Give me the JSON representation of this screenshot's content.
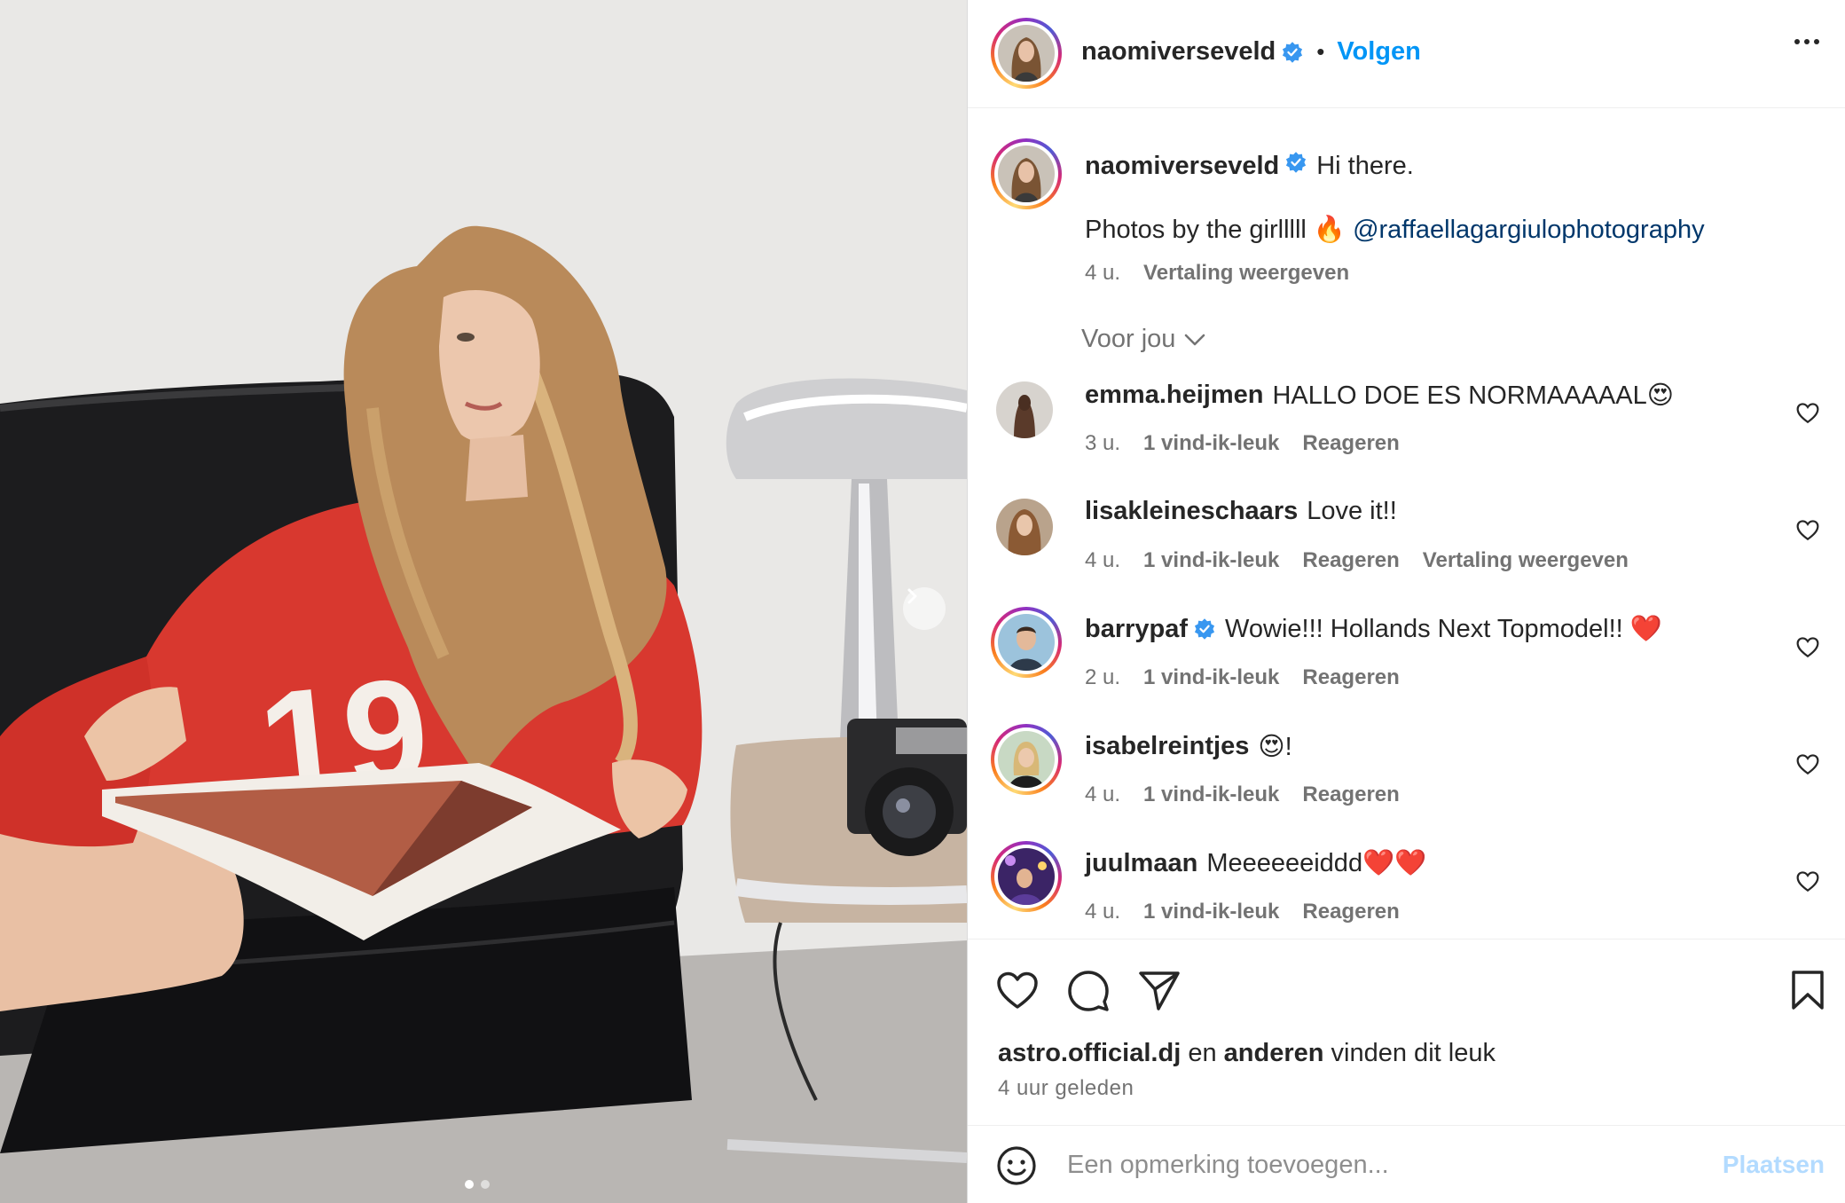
{
  "post": {
    "author": "naomiverseveld",
    "follow_label": "Volgen",
    "caption_text": "Hi there.",
    "caption_line2_prefix": "Photos by the girlllll 🔥",
    "caption_mention": "@raffaellagargiulophotography",
    "caption_time": "4 u.",
    "caption_translate": "Vertaling weergeven",
    "section_label": "Voor jou",
    "likes_user": "astro.official.dj",
    "likes_en": "en",
    "likes_others": "anderen",
    "likes_suffix": "vinden dit leuk",
    "time_ago": "4 uur geleden",
    "comment_placeholder": "Een opmerking toevoegen...",
    "post_label": "Plaatsen",
    "carousel": {
      "current": 1,
      "total": 2
    }
  },
  "comments": [
    {
      "user": "emma.heijmen",
      "verified": false,
      "text": "HALLO DOE ES NORMAAAAAL😍",
      "time": "3 u.",
      "likes": "1 vind-ik-leuk",
      "reply": "Reageren",
      "translate": "",
      "story_ring": false
    },
    {
      "user": "lisakleineschaars",
      "verified": false,
      "text": "Love it!!",
      "time": "4 u.",
      "likes": "1 vind-ik-leuk",
      "reply": "Reageren",
      "translate": "Vertaling weergeven",
      "story_ring": false
    },
    {
      "user": "barrypaf",
      "verified": true,
      "text": "Wowie!!! Hollands Next Topmodel!! ❤️",
      "time": "2 u.",
      "likes": "1 vind-ik-leuk",
      "reply": "Reageren",
      "translate": "",
      "story_ring": true
    },
    {
      "user": "isabelreintjes",
      "verified": false,
      "text": "😍!",
      "time": "4 u.",
      "likes": "1 vind-ik-leuk",
      "reply": "Reageren",
      "translate": "",
      "story_ring": true
    },
    {
      "user": "juulmaan",
      "verified": false,
      "text": "Meeeeeeiddd❤️❤️",
      "time": "4 u.",
      "likes": "1 vind-ik-leuk",
      "reply": "Reageren",
      "translate": "",
      "story_ring": true
    }
  ],
  "icons": {
    "like": "heart-icon",
    "comment": "comment-bubble-icon",
    "share": "paper-plane-icon",
    "save": "bookmark-icon",
    "emoji": "emoji-smile-icon",
    "more": "more-options-icon",
    "verified": "verified-badge-icon",
    "next": "chevron-right-icon"
  },
  "colors": {
    "link_blue": "#0095f6",
    "mention_blue": "#00376b",
    "verified_blue": "#3897f0",
    "muted_text": "#737373",
    "post_button_disabled": "#b3dbff"
  }
}
